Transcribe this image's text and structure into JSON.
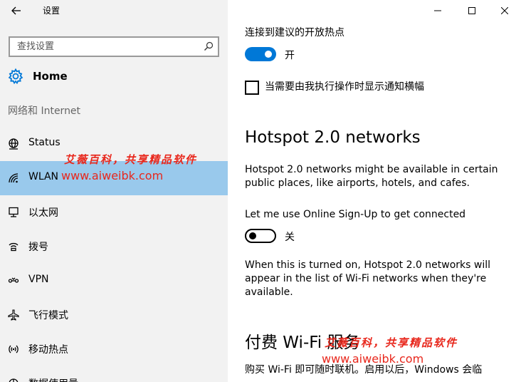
{
  "window": {
    "title": "设置",
    "back_icon": "arrow-left-icon",
    "controls": [
      "minimize-icon",
      "maximize-icon",
      "close-icon"
    ]
  },
  "sidebar": {
    "search": {
      "placeholder": "查找设置",
      "value": ""
    },
    "home": {
      "label": "Home",
      "icon": "gear-icon"
    },
    "section": "网络和 Internet",
    "items": [
      {
        "label": "Status",
        "icon": "globe-icon",
        "active": false
      },
      {
        "label": "WLAN",
        "icon": "wifi-icon",
        "active": true
      },
      {
        "label": "以太网",
        "icon": "ethernet-icon",
        "active": false
      },
      {
        "label": "拨号",
        "icon": "dialup-icon",
        "active": false
      },
      {
        "label": "VPN",
        "icon": "vpn-icon",
        "active": false
      },
      {
        "label": "飞行模式",
        "icon": "airplane-icon",
        "active": false
      },
      {
        "label": "移动热点",
        "icon": "hotspot-icon",
        "active": false
      },
      {
        "label": "数据使用量",
        "icon": "data-usage-icon",
        "active": false
      }
    ]
  },
  "content": {
    "open_hotspot_label": "连接到建议的开放热点",
    "open_hotspot_state": "开",
    "notify_checkbox_label": "当需要由我执行操作时显示通知横幅",
    "hotspot20_heading": "Hotspot 2.0 networks",
    "hotspot20_desc_line1": "Hotspot 2.0 networks might be available in certain",
    "hotspot20_desc_line2": "public places, like airports, hotels, and cafes.",
    "signup_label": "Let me use Online Sign-Up to get connected",
    "signup_state": "关",
    "signup_desc_line1": "When this is turned on, Hotspot 2.0 networks will",
    "signup_desc_line2": "appear in the list of Wi-Fi networks when they're",
    "signup_desc_line3": "available.",
    "paid_wifi_heading": "付费 Wi-Fi 服务",
    "paid_wifi_desc": "购买 Wi-Fi 即可随时联机。启用以后，Windows 会临"
  },
  "watermark": {
    "cn": "艾薇百科，共享精品软件",
    "url": "www.aiweibk.com"
  },
  "colors": {
    "accent": "#0078d7",
    "active_nav": "#99c9ec",
    "sidebar_bg": "#f2f2f2",
    "watermark": "#e8271c"
  }
}
